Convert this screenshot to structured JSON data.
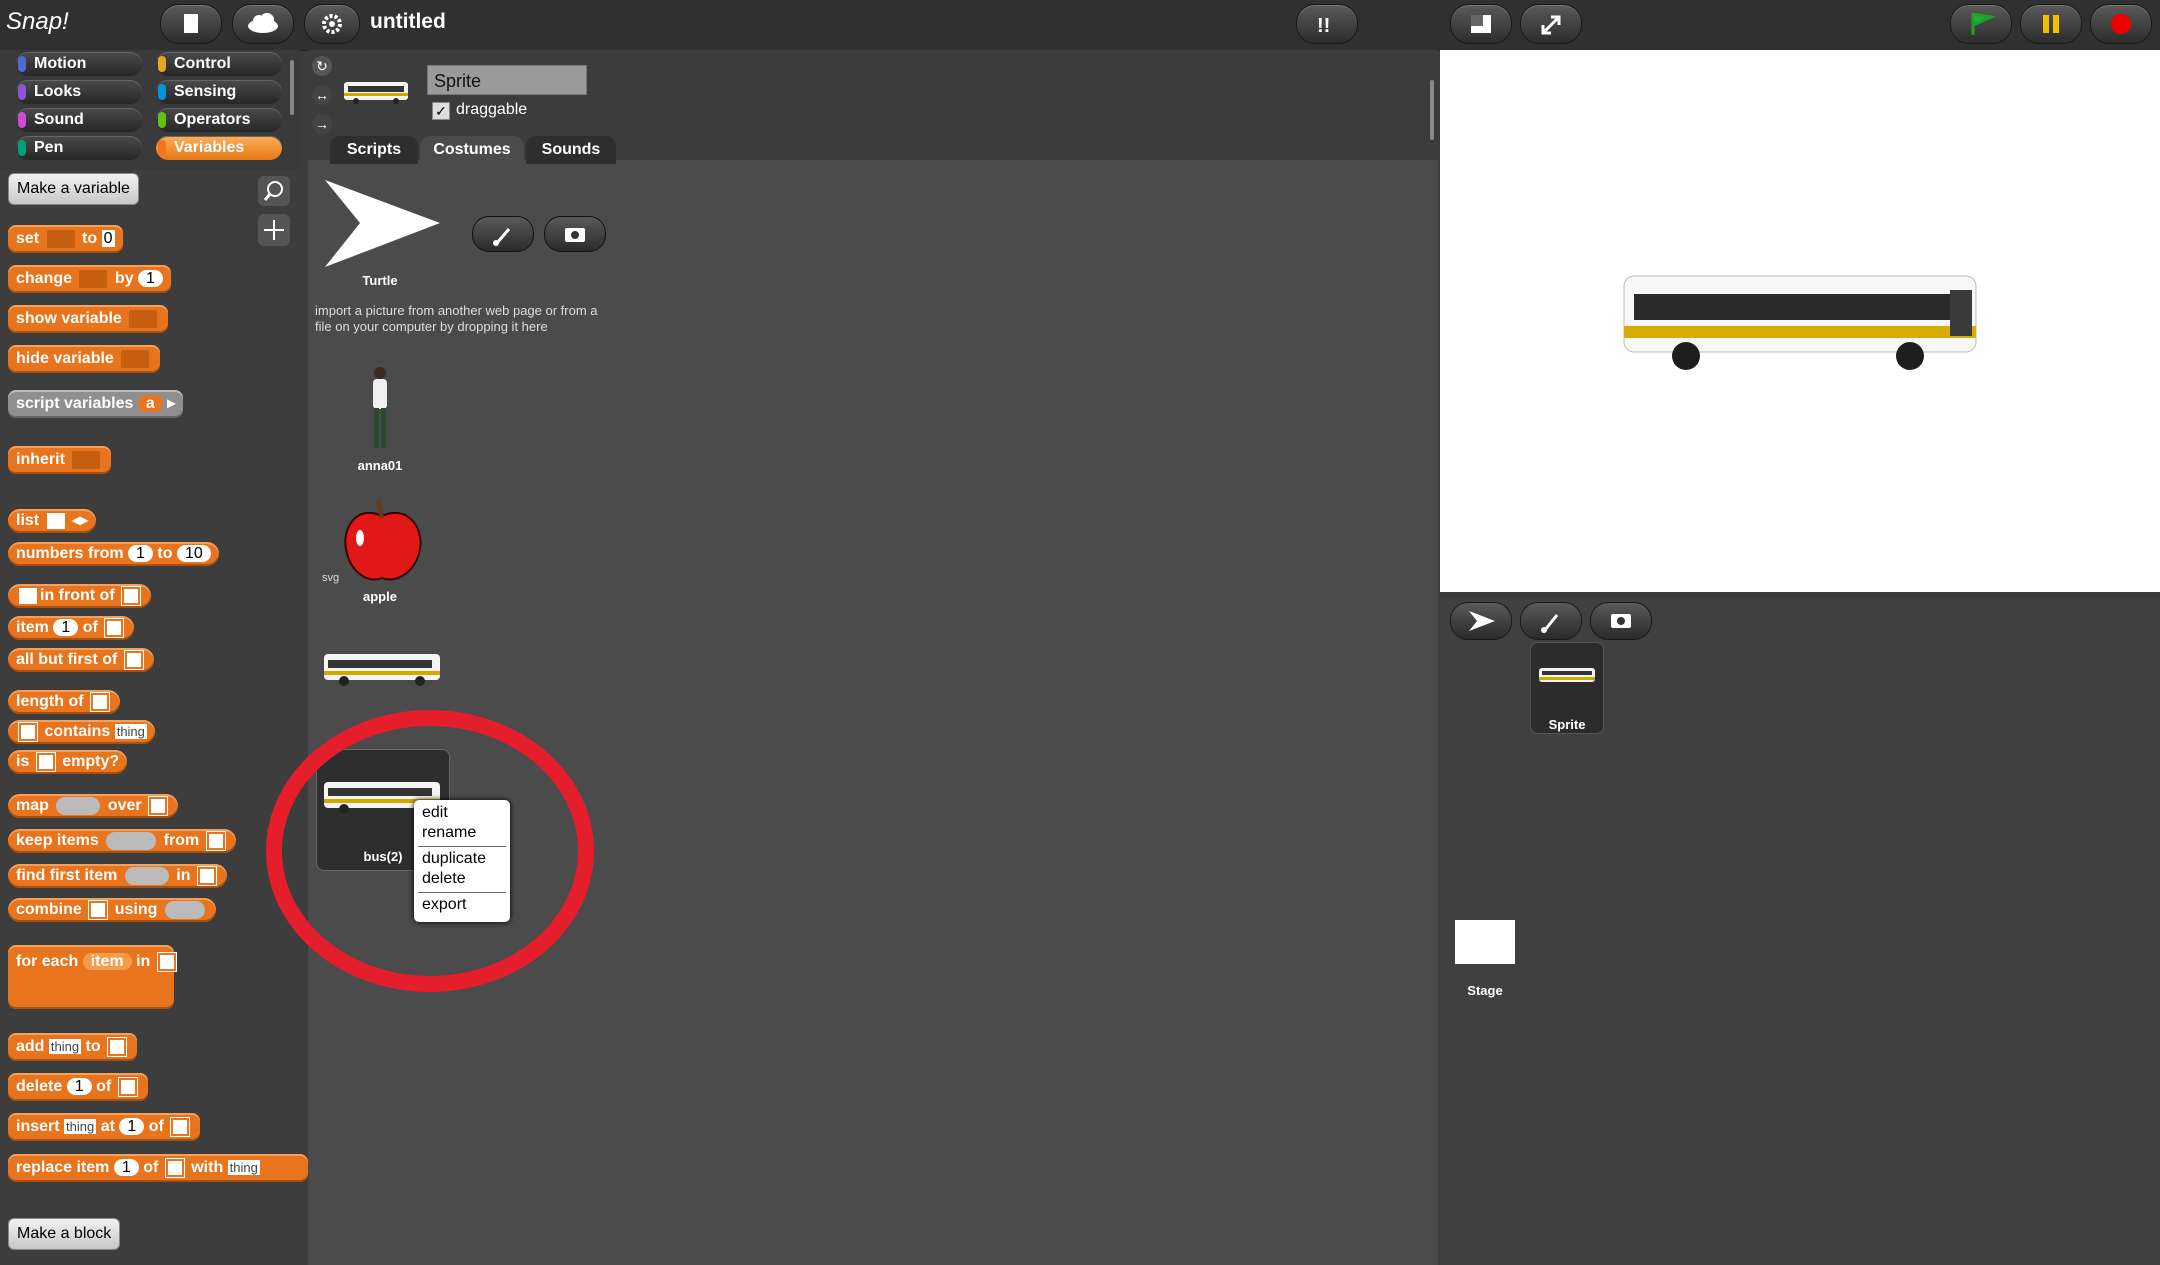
{
  "topbar": {
    "logo": "Snap!",
    "project_title": "untitled"
  },
  "categories": [
    {
      "label": "Motion",
      "color": "#4a6cd4"
    },
    {
      "label": "Control",
      "color": "#e6a822"
    },
    {
      "label": "Looks",
      "color": "#8a55d7"
    },
    {
      "label": "Sensing",
      "color": "#0494dc"
    },
    {
      "label": "Sound",
      "color": "#cf4ad9"
    },
    {
      "label": "Operators",
      "color": "#62c213"
    },
    {
      "label": "Pen",
      "color": "#00a178"
    },
    {
      "label": "Variables",
      "color": "#f3761d"
    }
  ],
  "palette": {
    "make_variable": "Make a variable",
    "make_block": "Make a block",
    "blocks": {
      "set": "set",
      "to": "to",
      "set_val": "0",
      "change": "change",
      "by": "by",
      "change_val": "1",
      "show_variable": "show variable",
      "hide_variable": "hide variable",
      "script_variables": "script variables",
      "script_var": "a",
      "inherit": "inherit",
      "list": "list",
      "numbers_from": "numbers from",
      "nf_from": "1",
      "nf_to_label": "to",
      "nf_to": "10",
      "in_front_of": "in front of",
      "item": "item",
      "item_val": "1",
      "of": "of",
      "all_but_first_of": "all but first of",
      "length_of": "length of",
      "contains": "contains",
      "thing": "thing",
      "is": "is",
      "empty": "empty?",
      "map": "map",
      "over": "over",
      "keep_items": "keep items",
      "from": "from",
      "find_first_item": "find first item",
      "in": "in",
      "combine": "combine",
      "using": "using",
      "for_each": "for each",
      "fe_item": "item",
      "fe_in": "in",
      "add": "add",
      "add_thing": "thing",
      "add_to": "to",
      "delete": "delete",
      "del_val": "1",
      "del_of": "of",
      "insert": "insert",
      "ins_thing": "thing",
      "at": "at",
      "ins_val": "1",
      "ins_of": "of",
      "replace_item": "replace item",
      "rep_val": "1",
      "rep_of": "of",
      "with": "with",
      "rep_thing": "thing"
    }
  },
  "sprite": {
    "name": "Sprite",
    "draggable_label": "draggable",
    "draggable": true
  },
  "tabs": [
    "Scripts",
    "Costumes",
    "Sounds"
  ],
  "costumes": {
    "turtle": "Turtle",
    "hint": "import a picture from another web page or from a file on your computer by dropping it here",
    "items": [
      {
        "label": "anna01"
      },
      {
        "label": "apple",
        "tag": "svg"
      },
      {
        "label": ""
      },
      {
        "label": "bus(2)"
      }
    ]
  },
  "context_menu": [
    "edit",
    "rename",
    "duplicate",
    "delete",
    "export"
  ],
  "corral": {
    "sprite_label": "Sprite",
    "stage_label": "Stage"
  }
}
